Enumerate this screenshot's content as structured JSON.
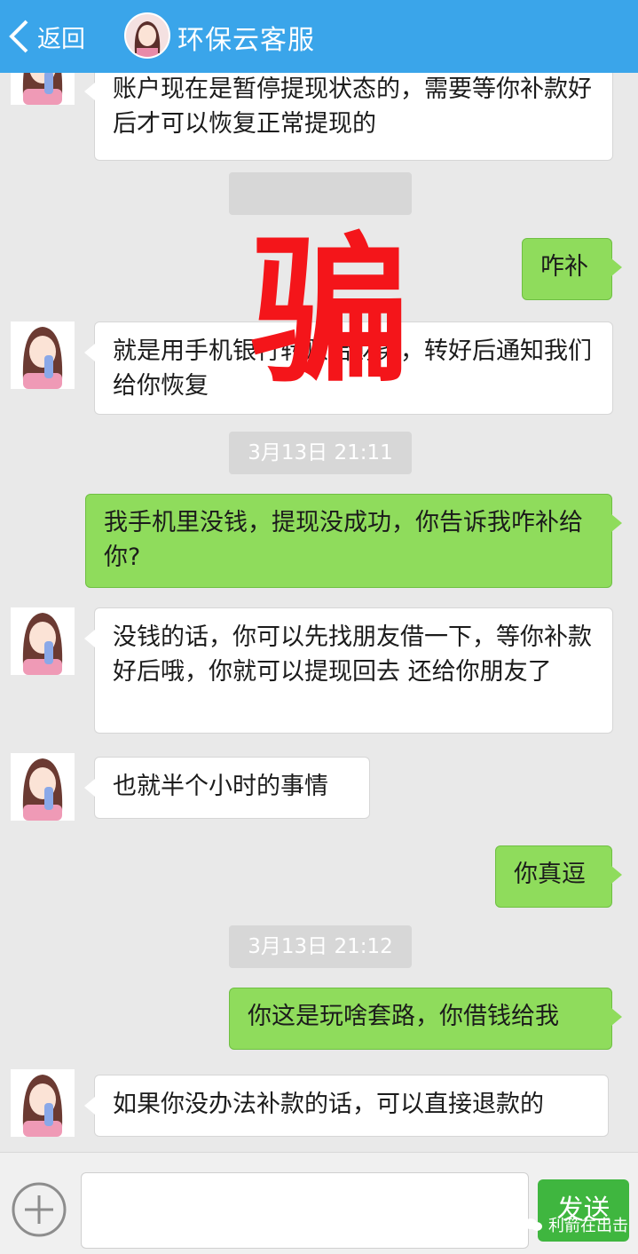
{
  "header": {
    "back_label": "返回",
    "title": "环保云客服",
    "bg_color": "#3aa5ea"
  },
  "messages": [
    {
      "type": "in",
      "text_partial": "账户现在是暂停提现状态的，需要等你补款好后才可以恢复正常提现的"
    },
    {
      "type": "out",
      "text": "咋补"
    },
    {
      "type": "in",
      "text": "就是用手机银行转账给财务，转好后通知我们给你恢复"
    },
    {
      "type": "time",
      "text": "3月13日 21:11"
    },
    {
      "type": "out",
      "text": "我手机里没钱，提现没成功，你告诉我咋补给你?"
    },
    {
      "type": "in",
      "text": "没钱的话，你可以先找朋友借一下，等你补款好后哦，你就可以提现回去 还给你朋友了"
    },
    {
      "type": "in",
      "text": "也就半个小时的事情"
    },
    {
      "type": "out",
      "text": "你真逗"
    },
    {
      "type": "time",
      "text": "3月13日 21:12"
    },
    {
      "type": "out",
      "text": "你这是玩啥套路，你借钱给我"
    },
    {
      "type": "in",
      "text": "如果你没办法补款的话，可以直接退款的"
    }
  ],
  "overlay": {
    "stamp_text": "骗",
    "stamp_color": "#f4151a"
  },
  "input_bar": {
    "send_label": "发送",
    "send_color": "#3fb63f",
    "plus_icon": "plus-circle-icon"
  },
  "watermark": {
    "text": "利箭在出击"
  }
}
